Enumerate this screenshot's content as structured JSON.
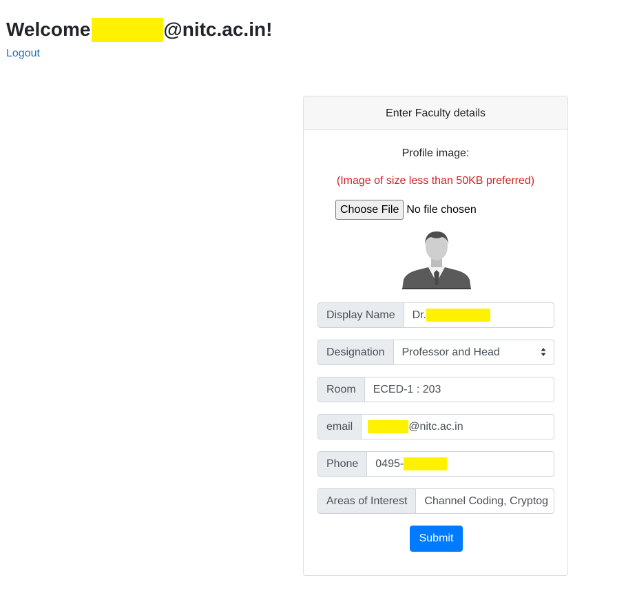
{
  "header": {
    "welcome_prefix": "Welcome",
    "welcome_suffix": "@nitc.ac.in!",
    "logout_label": "Logout"
  },
  "form": {
    "title": "Enter Faculty details",
    "profile_label": "Profile image:",
    "size_hint": "(Image of size less than 50KB preferred)",
    "choose_file_label": "Choose File",
    "file_status": "No file chosen",
    "display_name": {
      "label": "Display Name",
      "value_prefix": "Dr."
    },
    "designation": {
      "label": "Designation",
      "value": "Professor and Head"
    },
    "room": {
      "label": "Room",
      "value": "ECED-1 : 203"
    },
    "email": {
      "label": "email",
      "value_suffix": "@nitc.ac.in"
    },
    "phone": {
      "label": "Phone",
      "value_prefix": "0495-"
    },
    "interests": {
      "label": "Areas of Interest",
      "value": "Channel Coding, Cryptog"
    },
    "submit_label": "Submit"
  },
  "colors": {
    "redaction": "#fff200",
    "link": "#1a73c9",
    "hint": "#d01f1f",
    "primary_button": "#007bff"
  }
}
